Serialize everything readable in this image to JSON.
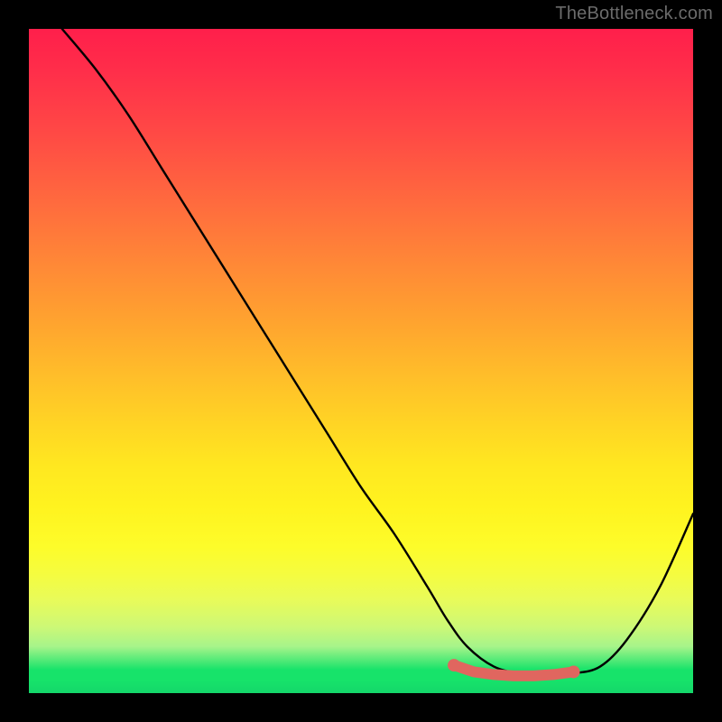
{
  "watermark": "TheBottleneck.com",
  "chart_data": {
    "type": "line",
    "title": "",
    "xlabel": "",
    "ylabel": "",
    "xlim": [
      0,
      100
    ],
    "ylim": [
      0,
      100
    ],
    "grid": false,
    "legend": false,
    "series": [
      {
        "name": "bottleneck-curve",
        "color": "#000000",
        "x": [
          5,
          10,
          15,
          20,
          25,
          30,
          35,
          40,
          45,
          50,
          55,
          60,
          63,
          66,
          70,
          74,
          78,
          82,
          86,
          90,
          95,
          100
        ],
        "values": [
          100,
          94,
          87,
          79,
          71,
          63,
          55,
          47,
          39,
          31,
          24,
          16,
          11,
          7,
          4,
          3,
          3,
          3,
          4,
          8,
          16,
          27
        ]
      },
      {
        "name": "slack-band",
        "color": "#e0665f",
        "x": [
          64,
          67,
          70,
          73,
          76,
          79,
          82
        ],
        "values": [
          4.2,
          3.2,
          2.8,
          2.6,
          2.6,
          2.8,
          3.2
        ]
      }
    ],
    "background_gradient": {
      "top": "#ff1f4b",
      "mid": "#fff31f",
      "bottom": "#17e36a"
    }
  }
}
